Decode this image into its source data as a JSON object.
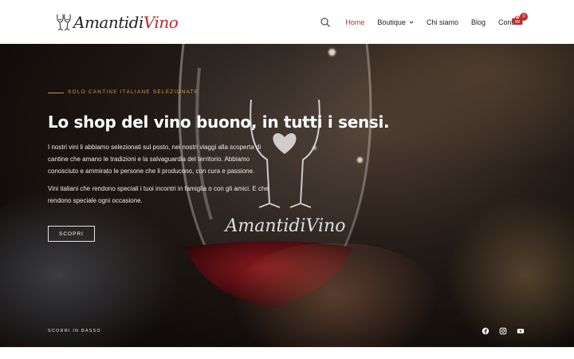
{
  "header": {
    "logo_text_main": "Amantidi",
    "logo_text_accent": "Vino",
    "nav": [
      {
        "label": "Home",
        "active": true
      },
      {
        "label": "Boutique",
        "dropdown": true
      },
      {
        "label": "Chi siamo"
      },
      {
        "label": "Blog"
      },
      {
        "label": "Contatti"
      }
    ],
    "cart_count": "0",
    "colors": {
      "accent": "#c0272d",
      "text": "#222222"
    },
    "icons": [
      "search-icon",
      "chevron-down-icon",
      "cart-icon"
    ]
  },
  "hero": {
    "eyebrow": "SOLO CANTINE ITALIANE SELEZIONATE",
    "headline": "Lo shop del vino buono, in tutti i sensi.",
    "paragraph1": "I nostri vini li abbiamo selezionati sul posto, nei nostri viaggi alla scoperta di cantine che amano le tradizioni e la salvaguardia del territorio. Abbiamo conosciuto e ammirato le persone che li producono, con cura e passione.",
    "paragraph2": "Vini italiani che rendono speciali i tuoi incontri in famiglia o con gli amici. E che rendono speciale ogni occasione.",
    "cta_label": "SCOPRI",
    "watermark_text": "AmantidiVino",
    "scroll_label": "SCORRI IN BASSO",
    "social_icons": [
      "facebook-icon",
      "instagram-icon",
      "youtube-icon"
    ],
    "colors": {
      "eyebrow": "#d39b3a",
      "wine": "#5c0f12"
    }
  }
}
